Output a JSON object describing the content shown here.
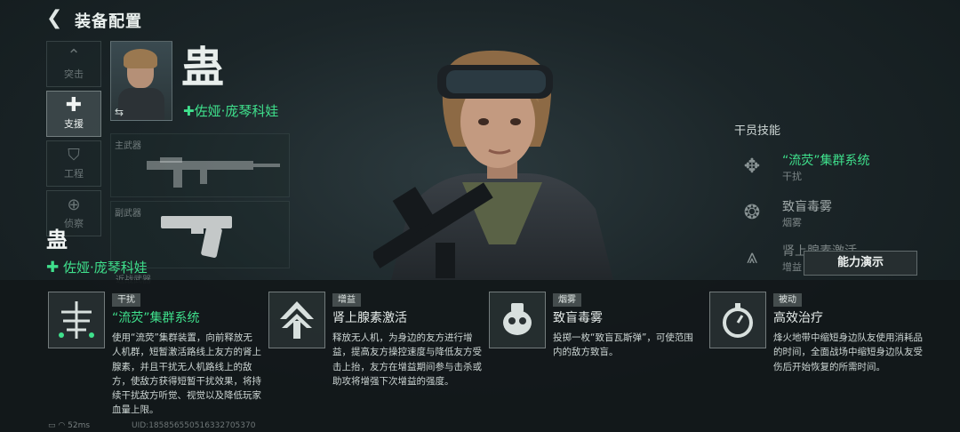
{
  "header": {
    "title": "装备配置"
  },
  "roles": [
    {
      "label": "突击",
      "icon": "chevron-up-icon"
    },
    {
      "label": "支援",
      "icon": "plus-icon"
    },
    {
      "label": "工程",
      "icon": "shield-icon"
    },
    {
      "label": "侦察",
      "icon": "crosshair-icon"
    }
  ],
  "operator": {
    "codename": "蛊",
    "real_name": "佐娅·庞琴科娃"
  },
  "weapons": {
    "primary_label": "主武器",
    "secondary_label": "副武器",
    "melee_label": "近战武器"
  },
  "skills_panel": {
    "title": "干员技能",
    "items": [
      {
        "name": "“流荧”集群系统",
        "category": "干扰"
      },
      {
        "name": "致盲毒雾",
        "category": "烟雾"
      },
      {
        "name": "肾上腺素激活",
        "category": "增益"
      }
    ],
    "demo_button": "能力演示"
  },
  "cards": [
    {
      "tag": "干扰",
      "name": "“流荧”集群系统",
      "desc": "使用“流荧”集群装置，向前释放无人机群，短暂激活路线上友方的肾上腺素，并且干扰无人机路线上的敌方，使敌方获得短暂干扰效果，将持续干扰敌方听觉、视觉以及降低玩家血量上限。",
      "icon": "drone-swarm-icon"
    },
    {
      "tag": "增益",
      "name": "肾上腺素激活",
      "desc": "释放无人机，为身边的友方进行增益，提高友方操控速度与降低友方受击上抬，友方在增益期间参与击杀或助攻将增强下次增益的强度。",
      "icon": "adrenaline-icon"
    },
    {
      "tag": "烟雾",
      "name": "致盲毒雾",
      "desc": "投掷一枚“致盲瓦斯弹”，可使范围内的敌方致盲。",
      "icon": "gas-grenade-icon"
    },
    {
      "tag": "被动",
      "name": "高效治疗",
      "desc": "烽火地带中缩短身边队友使用消耗品的时间，全面战场中缩短身边队友受伤后开始恢复的所需时间。",
      "icon": "healing-icon"
    }
  ],
  "status": {
    "ping": "52ms",
    "uid": "UID:18585655051633270537​0"
  },
  "colors": {
    "accent": "#3fe08c"
  }
}
